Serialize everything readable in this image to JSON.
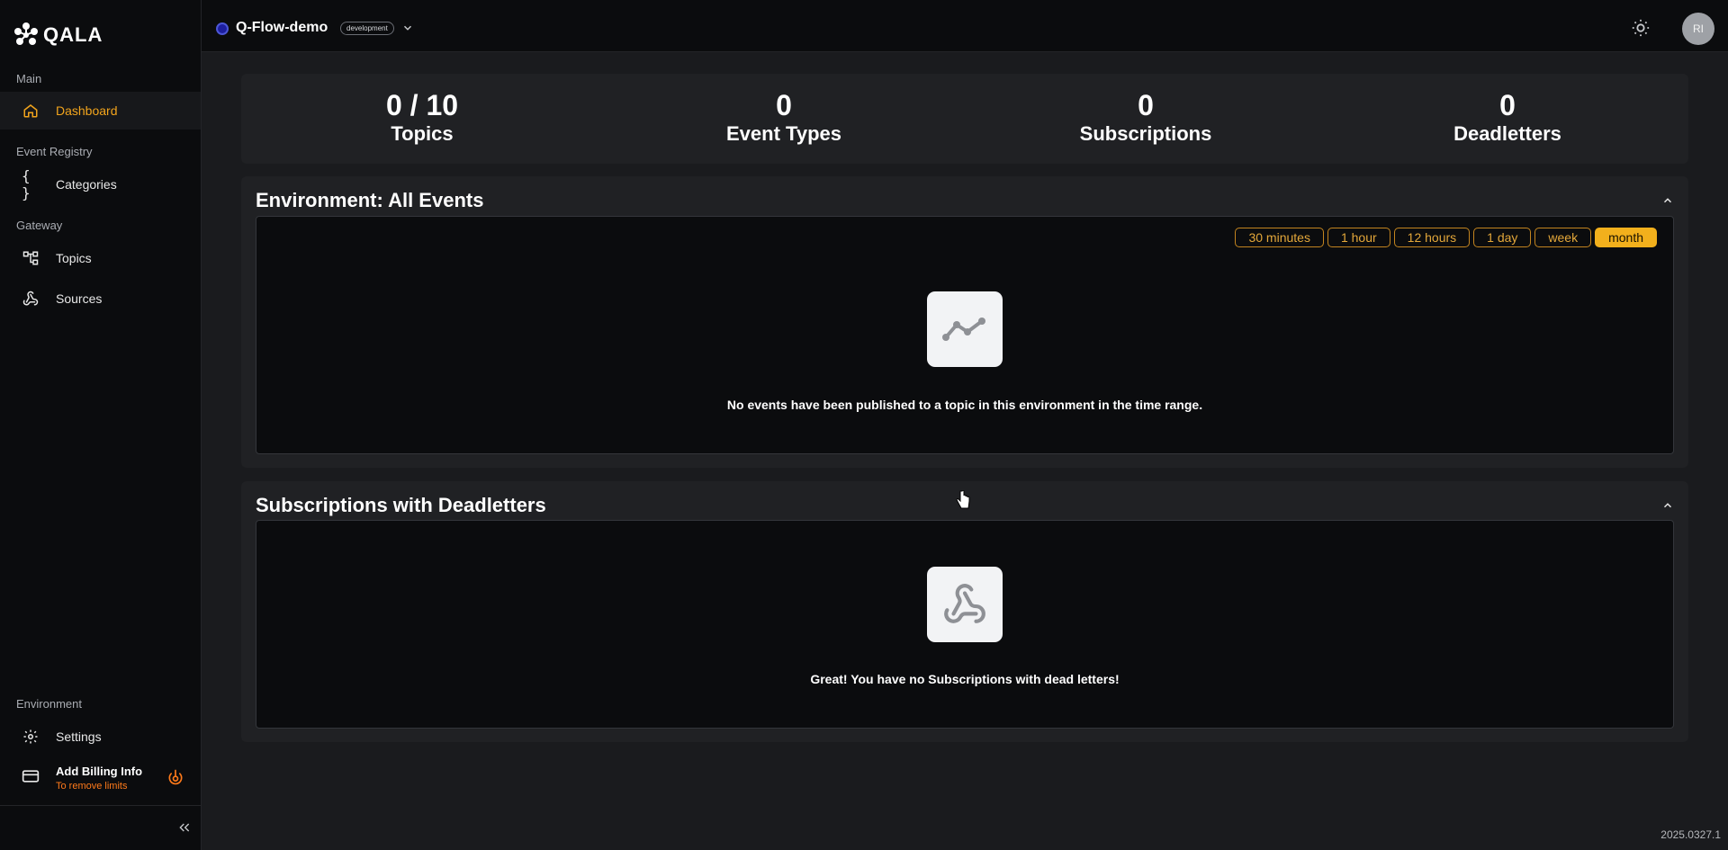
{
  "sidebar": {
    "logo_text": "QALA",
    "sections": {
      "main": "Main",
      "event_registry": "Event Registry",
      "gateway": "Gateway",
      "environment": "Environment"
    },
    "items": {
      "dashboard": "Dashboard",
      "categories": "Categories",
      "topics": "Topics",
      "sources": "Sources",
      "settings": "Settings"
    },
    "billing": {
      "title": "Add Billing Info",
      "subtitle": "To remove limits"
    }
  },
  "header": {
    "project_name": "Q-Flow-demo",
    "env_badge": "development",
    "avatar_initials": "RI"
  },
  "stats": [
    {
      "value": "0 / 10",
      "label": "Topics"
    },
    {
      "value": "0",
      "label": "Event Types"
    },
    {
      "value": "0",
      "label": "Subscriptions"
    },
    {
      "value": "0",
      "label": "Deadletters"
    }
  ],
  "events_panel": {
    "title": "Environment: All Events",
    "ranges": [
      "30 minutes",
      "1 hour",
      "12 hours",
      "1 day",
      "week",
      "month"
    ],
    "active_range": "month",
    "empty_message": "No events have been published to a topic in this environment in the time range."
  },
  "deadletters_panel": {
    "title": "Subscriptions with Deadletters",
    "empty_message": "Great! You have no Subscriptions with dead letters!"
  },
  "footer": {
    "version": "2025.0327.1"
  },
  "colors": {
    "accent": "#f2a41c",
    "billing_subtitle": "#ff7a1a",
    "env_dot": "#1d1e9e"
  }
}
